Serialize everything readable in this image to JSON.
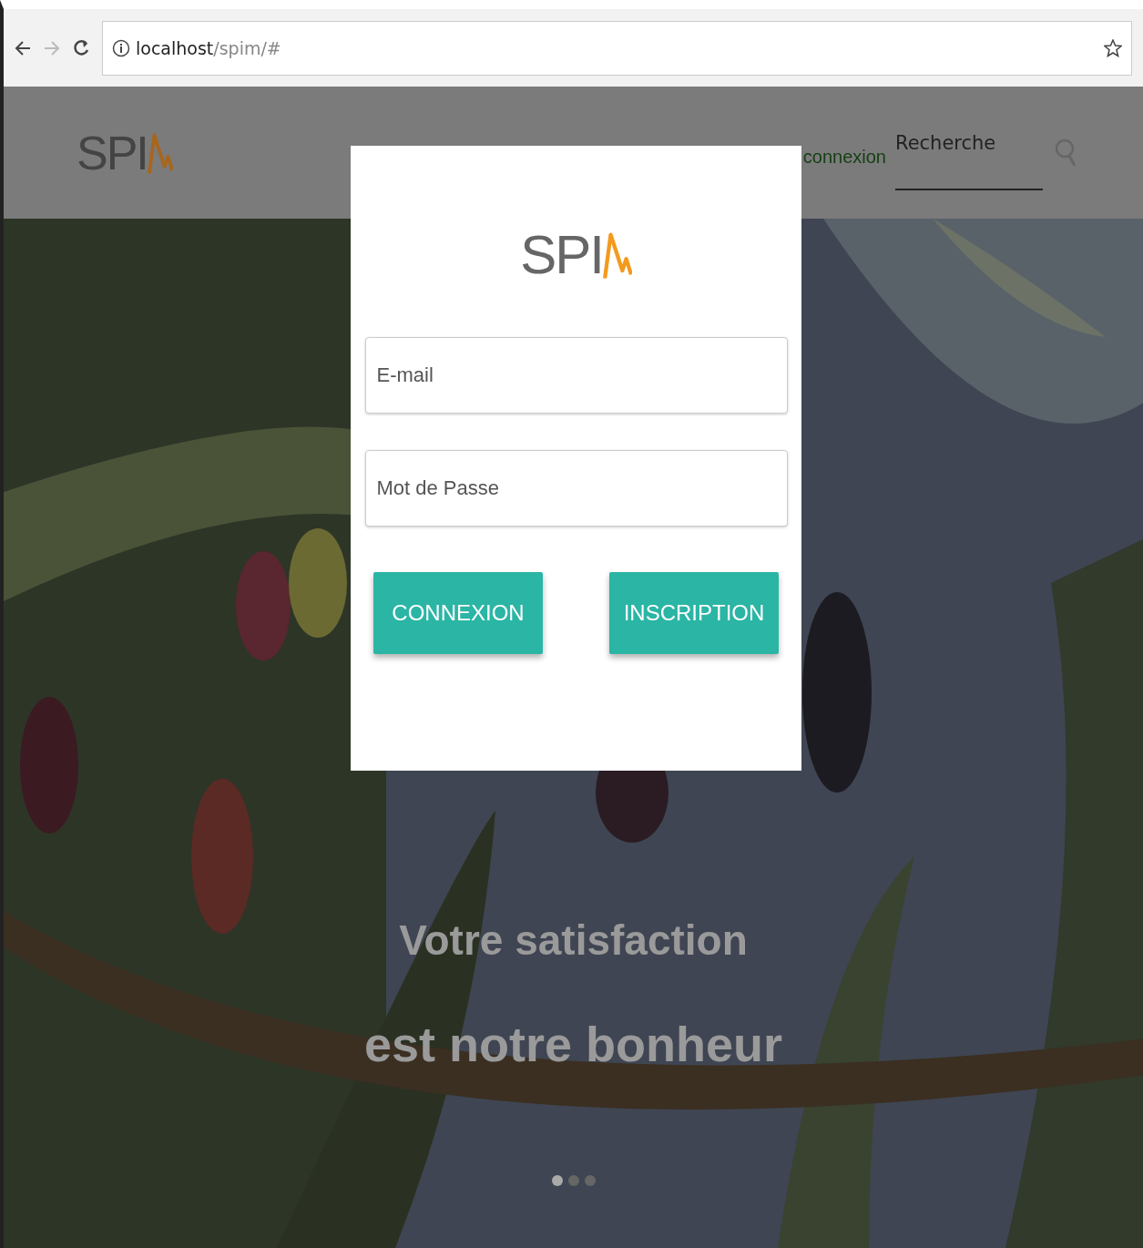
{
  "browser": {
    "url_host": "localhost",
    "url_path": "/spim/#"
  },
  "header": {
    "logo_text": "SPI",
    "connexion_link": "connexion",
    "search": {
      "placeholder": "Recherche"
    }
  },
  "hero": {
    "kind": "picture",
    "caption_line_1": "Votre satisfaction",
    "caption_line_2": "est notre bonheur",
    "dots": [
      {
        "selected": true
      },
      {
        "selected": false
      },
      {
        "selected": false
      }
    ]
  },
  "login_modal": {
    "logo_text": "SPI",
    "email": {
      "placeholder": "E-mail"
    },
    "password": {
      "placeholder": "Mot de Passe"
    },
    "buttons": [
      "CONNEXION",
      "INSCRIPTION"
    ]
  }
}
